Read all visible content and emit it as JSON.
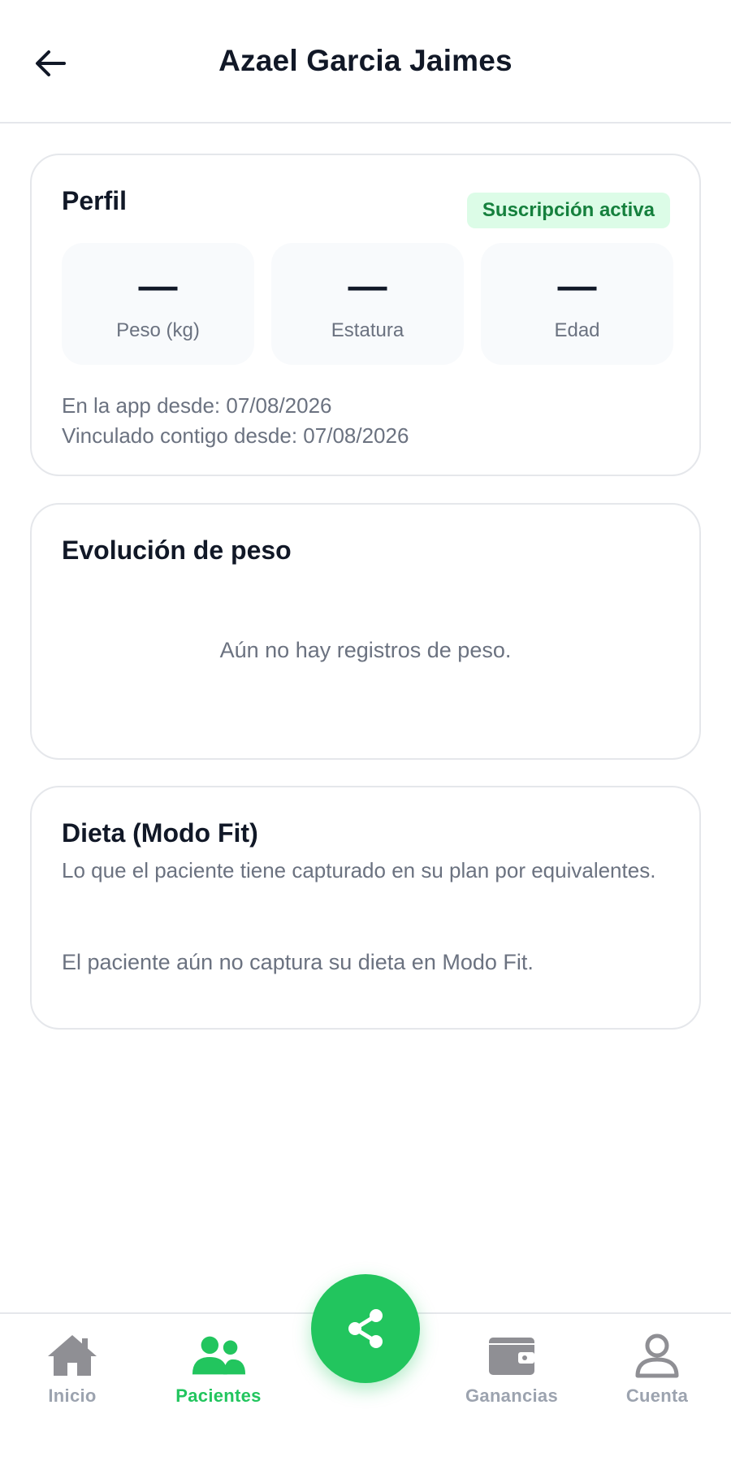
{
  "header": {
    "title": "Azael Garcia Jaimes",
    "back_icon": "arrow-left-icon"
  },
  "profile": {
    "title": "Perfil",
    "badge": "Suscripción activa",
    "stats": [
      {
        "value": "—",
        "label": "Peso (kg)"
      },
      {
        "value": "—",
        "label": "Estatura"
      },
      {
        "value": "—",
        "label": "Edad"
      }
    ],
    "in_app_since": "En la app desde: 07/08/2026",
    "linked_since": "Vinculado contigo desde: 07/08/2026"
  },
  "weight": {
    "title": "Evolución de peso",
    "empty": "Aún no hay registros de peso."
  },
  "diet": {
    "title": "Dieta (Modo Fit)",
    "subtitle": "Lo que el paciente tiene capturado en su plan por equivalentes.",
    "empty": "El paciente aún no captura su dieta en Modo Fit."
  },
  "tabbar": {
    "items": [
      {
        "label": "Inicio",
        "icon": "home-icon",
        "active": false
      },
      {
        "label": "Pacientes",
        "icon": "users-icon",
        "active": true
      },
      {
        "label": "Ganancias",
        "icon": "wallet-icon",
        "active": false
      },
      {
        "label": "Cuenta",
        "icon": "user-icon",
        "active": false
      }
    ],
    "fab_icon": "share-icon"
  },
  "colors": {
    "accent": "#22c55e",
    "badge_bg": "#dcfce7",
    "badge_text": "#15803d",
    "muted": "#6b7280",
    "inactive": "#9ca3af"
  }
}
